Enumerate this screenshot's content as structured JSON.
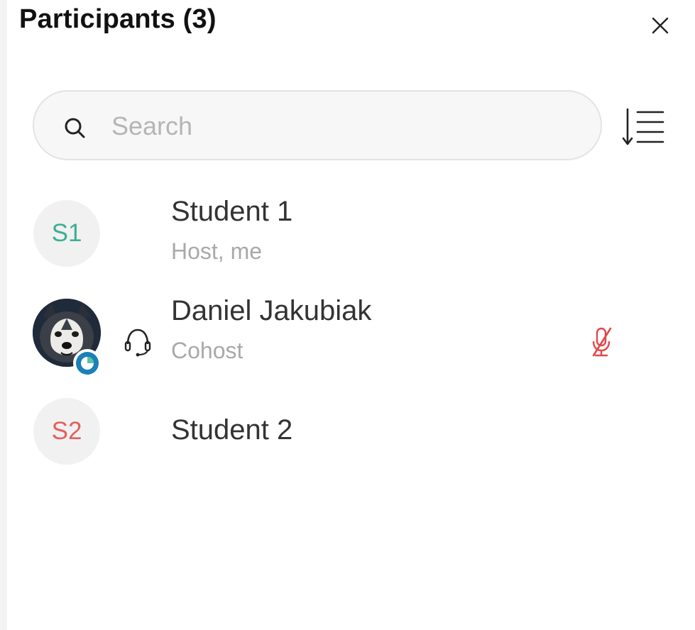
{
  "header": {
    "title": "Participants (3)",
    "close_icon": "close-icon"
  },
  "search": {
    "placeholder": "Search",
    "value": "",
    "icon": "search-icon"
  },
  "sort": {
    "icon": "sort-icon"
  },
  "participants": [
    {
      "initials": "S1",
      "name": "Student 1",
      "role": "Host, me",
      "initials_color": "#3fae95"
    },
    {
      "name": "Daniel Jakubiak",
      "role": "Cohost",
      "avatar": "husky-profile-photo",
      "status_icon": "presence-status-icon",
      "audio_icon": "headset-icon",
      "mic_icon": "muted-mic-icon",
      "mic_color": "#e0484b"
    },
    {
      "initials": "S2",
      "name": "Student 2",
      "initials_color": "#e4605b"
    }
  ]
}
